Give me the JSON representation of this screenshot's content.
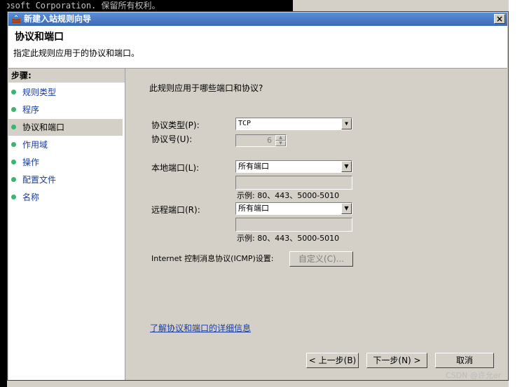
{
  "window": {
    "title": "新建入站规则向导",
    "close": "×"
  },
  "background": {
    "console_line": "rosoft Corporation. 保留所有权利。"
  },
  "header": {
    "title": "协议和端口",
    "subtitle": "指定此规则应用于的协议和端口。"
  },
  "steps": {
    "title": "步骤:",
    "items": [
      {
        "label": "规则类型",
        "active": false
      },
      {
        "label": "程序",
        "active": false
      },
      {
        "label": "协议和端口",
        "active": true
      },
      {
        "label": "作用域",
        "active": false
      },
      {
        "label": "操作",
        "active": false
      },
      {
        "label": "配置文件",
        "active": false
      },
      {
        "label": "名称",
        "active": false
      }
    ]
  },
  "main": {
    "question": "此规则应用于哪些端口和协议?",
    "protocol_type_label": "协议类型(P):",
    "protocol_type_value": "TCP",
    "protocol_number_label": "协议号(U):",
    "protocol_number_value": "6",
    "local_port_label": "本地端口(L):",
    "local_port_value": "所有端口",
    "local_example": "示例: 80、443、5000-5010",
    "remote_port_label": "远程端口(R):",
    "remote_port_value": "所有端口",
    "remote_example": "示例: 80、443、5000-5010",
    "icmp_label": "Internet 控制消息协议(ICMP)设置:",
    "customize_button": "自定义(C)...",
    "learn_more_link": "了解协议和端口的详细信息"
  },
  "buttons": {
    "back": "< 上一步(B)",
    "next": "下一步(N) >",
    "cancel": "取消"
  },
  "watermark": "CSDN @许允er"
}
